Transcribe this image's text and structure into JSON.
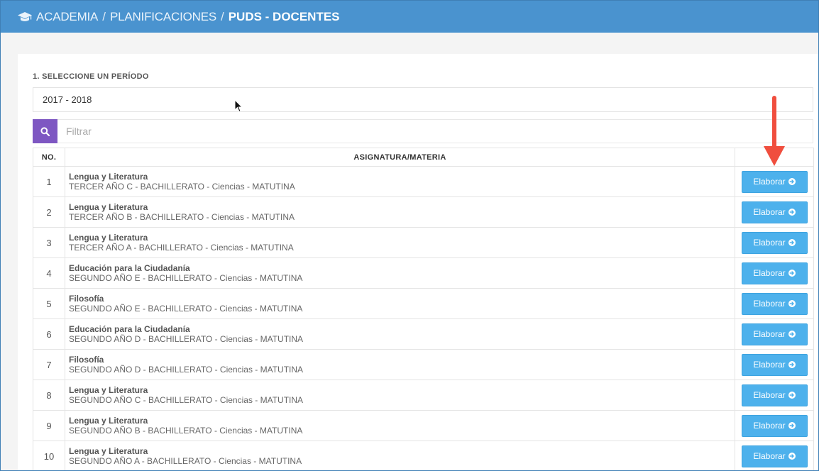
{
  "header": {
    "crumb1": "ACADEMIA",
    "separator": "/",
    "crumb2": "PLANIFICACIONES",
    "current": "PUDS - DOCENTES"
  },
  "period": {
    "label": "1. SELECCIONE UN PERÍODO",
    "value": "2017 - 2018"
  },
  "filter": {
    "placeholder": "Filtrar",
    "icon": "search-icon"
  },
  "table": {
    "columns": [
      "NO.",
      "ASIGNATURA/MATERIA",
      ""
    ],
    "action_label": "Elaborar",
    "rows": [
      {
        "no": "1",
        "subject": "Lengua y Literatura",
        "course": "TERCER AÑO C - BACHILLERATO - Ciencias - MATUTINA"
      },
      {
        "no": "2",
        "subject": "Lengua y Literatura",
        "course": "TERCER AÑO B - BACHILLERATO - Ciencias - MATUTINA"
      },
      {
        "no": "3",
        "subject": "Lengua y Literatura",
        "course": "TERCER AÑO A - BACHILLERATO - Ciencias - MATUTINA"
      },
      {
        "no": "4",
        "subject": "Educación para la Ciudadanía",
        "course": "SEGUNDO AÑO E - BACHILLERATO - Ciencias - MATUTINA"
      },
      {
        "no": "5",
        "subject": "Filosofía",
        "course": "SEGUNDO AÑO E - BACHILLERATO - Ciencias - MATUTINA"
      },
      {
        "no": "6",
        "subject": "Educación para la Ciudadanía",
        "course": "SEGUNDO AÑO D - BACHILLERATO - Ciencias - MATUTINA"
      },
      {
        "no": "7",
        "subject": "Filosofía",
        "course": "SEGUNDO AÑO D - BACHILLERATO - Ciencias - MATUTINA"
      },
      {
        "no": "8",
        "subject": "Lengua y Literatura",
        "course": "SEGUNDO AÑO C - BACHILLERATO - Ciencias - MATUTINA"
      },
      {
        "no": "9",
        "subject": "Lengua y Literatura",
        "course": "SEGUNDO AÑO B - BACHILLERATO - Ciencias - MATUTINA"
      },
      {
        "no": "10",
        "subject": "Lengua y Literatura",
        "course": "SEGUNDO AÑO A - BACHILLERATO - Ciencias - MATUTINA"
      }
    ]
  },
  "colors": {
    "header_bg": "#4a93cf",
    "button_bg": "#4db1ec",
    "filter_button_bg": "#7e57c2",
    "annotation_arrow": "#f04e3e"
  }
}
